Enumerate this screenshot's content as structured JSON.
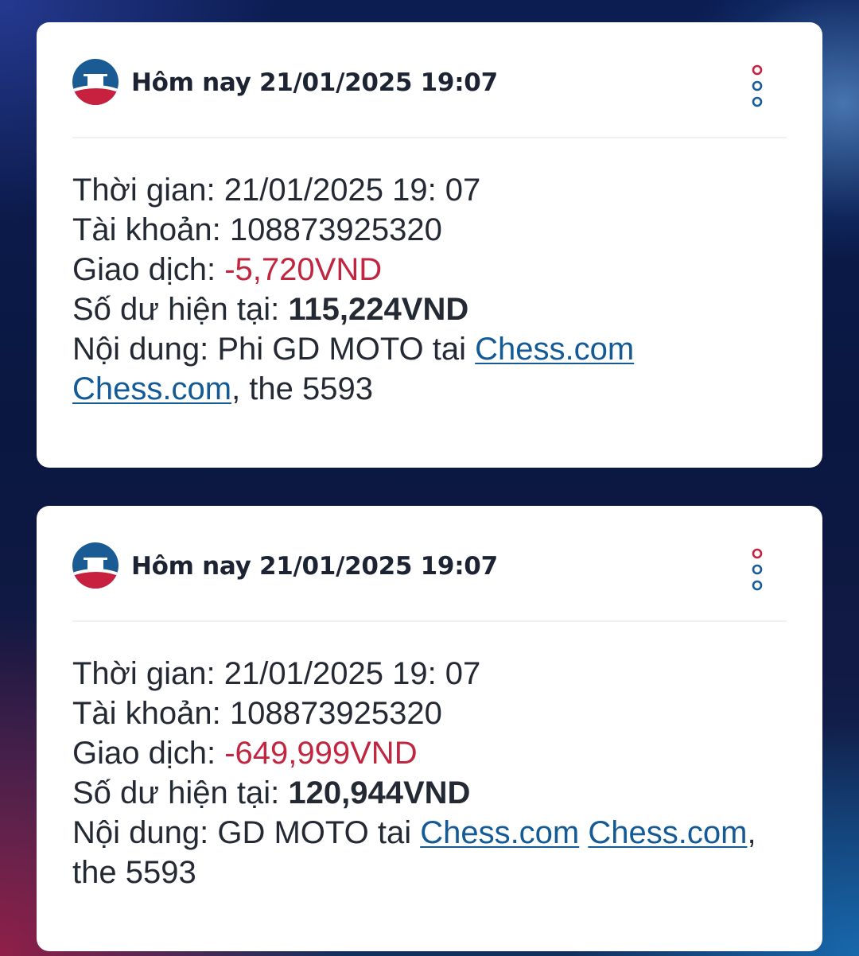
{
  "notifications": [
    {
      "header": "Hôm nay 21/01/2025 19:07",
      "time_label": "Thời gian: ",
      "time_value": "21/01/2025 19: 07",
      "account_label": "Tài khoản: ",
      "account_value": "108873925320",
      "transaction_label": "Giao dịch: ",
      "transaction_value": "-5,720VND",
      "balance_label": "Số dư hiện tại: ",
      "balance_value": "115,224VND",
      "content_label": "Nội dung: ",
      "content_text": "Phi GD MOTO tai ",
      "link_1": "Chess.com",
      "separator": " ",
      "link_2": "Chess.com",
      "content_suffix": ", the 5593"
    },
    {
      "header": "Hôm nay 21/01/2025 19:07",
      "time_label": "Thời gian: ",
      "time_value": "21/01/2025 19: 07",
      "account_label": "Tài khoản: ",
      "account_value": "108873925320",
      "transaction_label": "Giao dịch: ",
      "transaction_value": "-649,999VND",
      "balance_label": "Số dư hiện tại: ",
      "balance_value": "120,944VND",
      "content_label": "Nội dung: ",
      "content_text": "GD MOTO tai ",
      "link_1": "Chess.com",
      "separator": " ",
      "link_2": "Chess.com",
      "content_suffix": ", the 5593"
    }
  ],
  "icons": {
    "logo": "bank-logo-icon",
    "menu": "more-vertical-icon"
  },
  "colors": {
    "negative_amount": "#c0263f",
    "link": "#135a96",
    "brand_blue": "#1a5b94",
    "brand_red": "#c8203f"
  }
}
